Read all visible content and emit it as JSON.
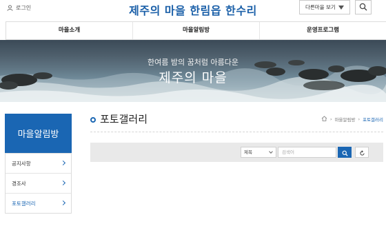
{
  "header": {
    "login_label": "로그인",
    "site_title": "제주의 마을 한림읍 한수리",
    "village_select_label": "다른마을 보기",
    "icons": {
      "login": "user-icon",
      "search": "search-icon",
      "select": "caret-down-icon"
    }
  },
  "nav": {
    "items": [
      {
        "label": "마을소개"
      },
      {
        "label": "마을알림방"
      },
      {
        "label": "운영프로그램"
      }
    ]
  },
  "hero": {
    "subtitle": "한여름 밤의 꿈처럼 아름다운",
    "title": "제주의 마을"
  },
  "sidebar": {
    "heading": "마을알림방",
    "items": [
      {
        "label": "공지사항"
      },
      {
        "label": "경조사"
      },
      {
        "label": "포토갤러리"
      }
    ],
    "active_index": 2
  },
  "main": {
    "page_title": "포토갤러리",
    "breadcrumb": [
      "마을알림방",
      "포토갤러리"
    ],
    "search": {
      "field_select": "제목",
      "keyword_placeholder": "검색어",
      "icons": {
        "submit": "search-icon",
        "reset": "reset-icon"
      }
    }
  },
  "colors": {
    "accent": "#1a66b3",
    "title_blue": "#1a5fa8",
    "search_panel_bg": "#e9e9e9"
  }
}
